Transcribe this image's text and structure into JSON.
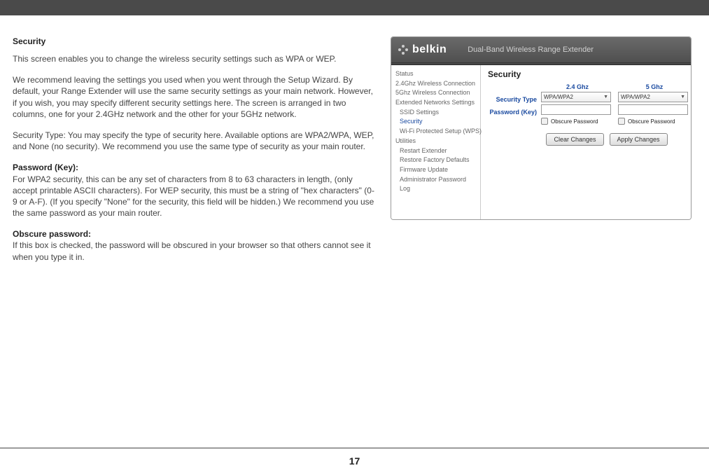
{
  "left": {
    "heading": "Security",
    "p1": "This screen enables you to change the wireless security settings such as WPA or WEP.",
    "p2a": "We recommend leaving the settings you used when you went through the Setup Wizard. By default, your Range Extender will use the same security settings as your main network. However, if you wish, you may specify different security settings here. The screen is arranged in two columns, one for your 2.4GHz network and the other for your 5GHz network.",
    "p3": "Security Type: You may specify the type of security here. Available options are WPA2/WPA, WEP, and None (no security). We recommend you use the same type of security as your main router.",
    "h2": "Password (Key):",
    "p4": "For WPA2 security, this can be any set of characters from 8 to 63 characters in length, (only accept printable ASCII characters). For WEP security, this must be a string of \"hex characters\" (0-9 or A-F). (If you specify \"None\" for the security, this field will be hidden.) We recommend you use the same password as your main router.",
    "h3": "Obscure password:",
    "p5": "If this box is checked, the password will be obscured in your browser so that others cannot see it when you type it in."
  },
  "device": {
    "brand": "belkin",
    "headerTitle": "Dual-Band Wireless Range Extender",
    "sidebar": {
      "status": "Status",
      "c24": "2.4Ghz Wireless Connection",
      "c5": "5Ghz Wireless Connection",
      "ext": "Extended Networks Settings",
      "ssid": "SSID Settings",
      "security": "Security",
      "wps": "Wi-Fi Protected Setup (WPS)",
      "utilities": "Utilities",
      "restart": "Restart Extender",
      "restore": "Restore Factory Defaults",
      "firmware": "Firmware Update",
      "admin": "Administrator Password",
      "log": "Log"
    },
    "panel": {
      "title": "Security",
      "band24": "2.4 Ghz",
      "band5": "5 Ghz",
      "secTypeLabel": "Security Type",
      "passLabel": "Password (Key)",
      "secType24": "WPA/WPA2",
      "secType5": "WPA/WPA2",
      "pass24": "",
      "pass5": "",
      "obscure": "Obscure Password",
      "clear": "Clear Changes",
      "apply": "Apply Changes"
    }
  },
  "page": "17"
}
